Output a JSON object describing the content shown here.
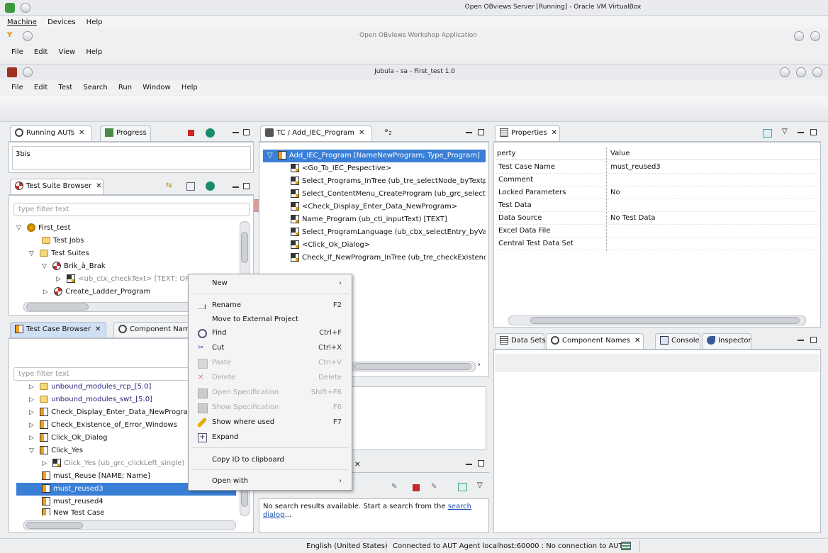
{
  "vbox": {
    "title": "Open OBviews Server [Running] - Oracle VM VirtualBox",
    "menu": [
      "Machine",
      "Devices",
      "Help"
    ]
  },
  "workshop": {
    "title": "Open OBviews Workshop Application",
    "menu": [
      "File",
      "Edit",
      "View",
      "Help"
    ]
  },
  "jubula": {
    "title": "Jubula - sa - First_test 1.0",
    "menu": [
      "File",
      "Edit",
      "Test",
      "Search",
      "Run",
      "Window",
      "Help"
    ]
  },
  "running_auts": {
    "tabs": [
      "Running AUTs",
      "Progress"
    ],
    "items": [
      "3bis"
    ]
  },
  "test_suite_browser": {
    "tab": "Test Suite Browser",
    "filter_placeholder": "type filter text",
    "tree": [
      {
        "label": "First_test"
      },
      {
        "label": "Test Jobs"
      },
      {
        "label": "Test Suites"
      },
      {
        "label": "Brik_à_Brak"
      },
      {
        "label": "<ub_ctx_checkText> [TEXT; OP..."
      },
      {
        "label": "Create_Ladder_Program"
      }
    ]
  },
  "test_case_browser": {
    "tabs": [
      "Test Case Browser",
      "Component Nam"
    ],
    "filter_placeholder": "type filter text",
    "tree": [
      {
        "label": "unbound_modules_rcp_[5.0]"
      },
      {
        "label": "unbound_modules_swt_[5.0]"
      },
      {
        "label": "Check_Display_Enter_Data_NewProgra"
      },
      {
        "label": "Check_Existence_of_Error_Windows"
      },
      {
        "label": "Click_Ok_Dialog"
      },
      {
        "label": "Click_Yes"
      },
      {
        "label": "Click_Yes (ub_grc_clickLeft_single)"
      },
      {
        "label": "must_Reuse [NAME; Name]"
      },
      {
        "label": "must_reused3"
      },
      {
        "label": "must_reused4"
      },
      {
        "label": "New Test Case"
      }
    ]
  },
  "tc_editor": {
    "tab": "TC / Add_IEC_Program",
    "overflow": "»",
    "overflow_count": "2",
    "root": "Add_IEC_Program [NameNewProgram; Type_Program]",
    "steps": [
      "<Go_To_IEC_Pespective>",
      "Select_Programs_InTree (ub_tre_selectNode_byTextp",
      "Select_ContentMenu_CreateProgram (ub_grc_selectC",
      "<Check_Display_Enter_Data_NewProgram>",
      "Name_Program (ub_cti_inputText) [TEXT]",
      "Select_ProgramLanguage (ub_cbx_selectEntry_byVa",
      "<Click_Ok_Dialog>",
      "Check_If_NewProgram_InTree (ub_tre_checkExistenc"
    ]
  },
  "search_view": {
    "message": "No search results available. Start a search from the ",
    "link": "search dialog",
    "suffix": "..."
  },
  "properties": {
    "tab": "Properties",
    "headers": [
      "perty",
      "Value"
    ],
    "rows": [
      {
        "k": "Test Case Name",
        "v": "must_reused3"
      },
      {
        "k": "Comment",
        "v": ""
      },
      {
        "k": "Locked Parameters",
        "v": "No"
      },
      {
        "k": "Test Data",
        "v": ""
      },
      {
        "k": "Data Source",
        "v": "No Test Data"
      },
      {
        "k": "Excel Data File",
        "v": ""
      },
      {
        "k": "Central Test Data Set",
        "v": ""
      }
    ]
  },
  "bottom_right_tabs": [
    "Data Sets",
    "Component Names",
    "Console",
    "Inspector"
  ],
  "context_menu": [
    {
      "label": "New",
      "shortcut": "",
      "submenu": true,
      "disabled": false,
      "icon": ""
    },
    {
      "label": "Rename",
      "shortcut": "F2",
      "disabled": false,
      "icon": "rename-icon"
    },
    {
      "label": "Move to External Project",
      "shortcut": "",
      "disabled": false,
      "icon": ""
    },
    {
      "label": "Find",
      "shortcut": "Ctrl+F",
      "disabled": false,
      "icon": "find-icon"
    },
    {
      "label": "Cut",
      "shortcut": "Ctrl+X",
      "disabled": false,
      "icon": "scissors-icon"
    },
    {
      "label": "Paste",
      "shortcut": "Ctrl+V",
      "disabled": true,
      "icon": "paste-icon"
    },
    {
      "label": "Delete",
      "shortcut": "Delete",
      "disabled": true,
      "icon": "delete-icon"
    },
    {
      "label": "Open Specification",
      "shortcut": "Shift+F6",
      "disabled": true,
      "icon": "open-spec-icon"
    },
    {
      "label": "Show Specification",
      "shortcut": "F6",
      "disabled": true,
      "icon": "show-spec-icon"
    },
    {
      "label": "Show where used",
      "shortcut": "F7",
      "disabled": false,
      "icon": "where-used-icon"
    },
    {
      "label": "Expand",
      "shortcut": "",
      "disabled": false,
      "icon": "expand-icon"
    },
    {
      "label": "Copy ID to clipboard",
      "shortcut": "",
      "disabled": false,
      "icon": ""
    },
    {
      "label": "Open with",
      "shortcut": "",
      "submenu": true,
      "disabled": false,
      "icon": ""
    }
  ],
  "status_bar": {
    "language": "English (United States)",
    "connection": "Connected to AUT Agent localhost:60000 : No connection to AUT"
  },
  "colors": {
    "selection": "#3a7fd6",
    "tab_active_blue": "#cfe0f4",
    "panel_border": "#b9c0c7"
  }
}
